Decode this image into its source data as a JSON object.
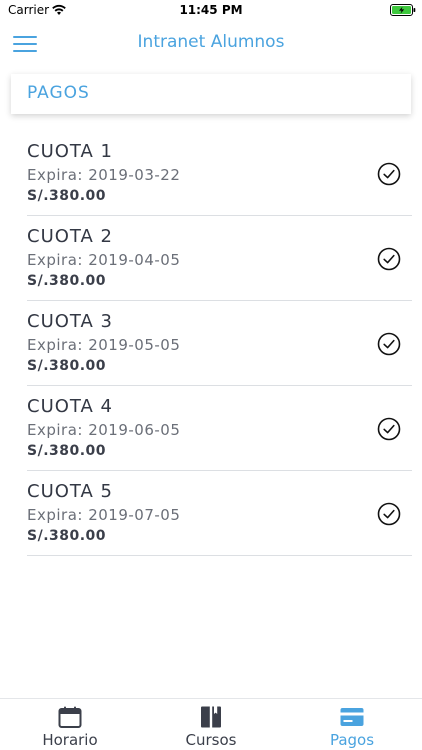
{
  "status_bar": {
    "carrier": "Carrier",
    "time": "11:45 PM",
    "wifi_icon": "wifi-icon",
    "battery_icon": "battery-charging-icon",
    "battery_color": "#3ec83e"
  },
  "nav": {
    "title": "Intranet Alumnos",
    "menu_icon": "hamburger-menu-icon"
  },
  "section": {
    "title": "PAGOS"
  },
  "payments": [
    {
      "title": "CUOTA 1",
      "expira": "Expira: 2019-03-22",
      "amount": "S/.380.00",
      "status_icon": "check-circle-icon"
    },
    {
      "title": "CUOTA 2",
      "expira": "Expira: 2019-04-05",
      "amount": "S/.380.00",
      "status_icon": "check-circle-icon"
    },
    {
      "title": "CUOTA 3",
      "expira": "Expira: 2019-05-05",
      "amount": "S/.380.00",
      "status_icon": "check-circle-icon"
    },
    {
      "title": "CUOTA 4",
      "expira": "Expira: 2019-06-05",
      "amount": "S/.380.00",
      "status_icon": "check-circle-icon"
    },
    {
      "title": "CUOTA 5",
      "expira": "Expira: 2019-07-05",
      "amount": "S/.380.00",
      "status_icon": "check-circle-icon"
    }
  ],
  "tabs": [
    {
      "label": "Horario",
      "icon": "calendar-icon",
      "active": false
    },
    {
      "label": "Cursos",
      "icon": "book-icon",
      "active": false
    },
    {
      "label": "Pagos",
      "icon": "credit-card-icon",
      "active": true
    }
  ],
  "colors": {
    "accent": "#4aa3df",
    "text": "#3b3f4a"
  }
}
